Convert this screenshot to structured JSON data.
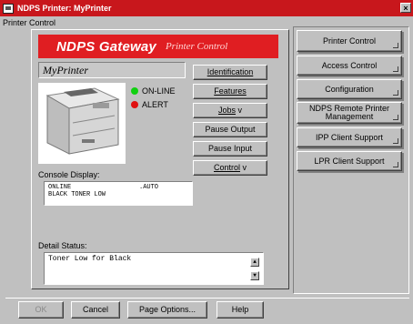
{
  "window": {
    "title": "NDPS Printer: MyPrinter",
    "close_glyph": "×",
    "section_label": "Printer Control"
  },
  "banner": {
    "title": "NDPS Gateway",
    "subtitle": "Printer Control"
  },
  "printer": {
    "name": "MyPrinter",
    "status_online": "ON-LINE",
    "status_alert": "ALERT",
    "online_color": "#10d010",
    "alert_color": "#e01010"
  },
  "actions": {
    "identification": "Identification",
    "features": "Features",
    "jobs": "Jobs",
    "pause_output": "Pause Output",
    "pause_input": "Pause Input",
    "control": "Control"
  },
  "console": {
    "label": "Console Display:",
    "line1_left": "ONLINE",
    "line1_right": ".AUTO",
    "line2": "BLACK TONER LOW"
  },
  "detail": {
    "label": "Detail Status:",
    "text": "Toner Low for Black"
  },
  "sidebar": {
    "items": [
      {
        "label": "Printer Control"
      },
      {
        "label": "Access Control"
      },
      {
        "label": "Configuration"
      },
      {
        "label": "NDPS Remote Printer Management"
      },
      {
        "label": "IPP Client Support"
      },
      {
        "label": "LPR Client Support"
      }
    ]
  },
  "footer": {
    "ok": "OK",
    "cancel": "Cancel",
    "page_options": "Page Options...",
    "help": "Help"
  },
  "icons": {
    "dropdown_glyph": "v",
    "scroll_up": "▲",
    "scroll_down": "▼"
  }
}
